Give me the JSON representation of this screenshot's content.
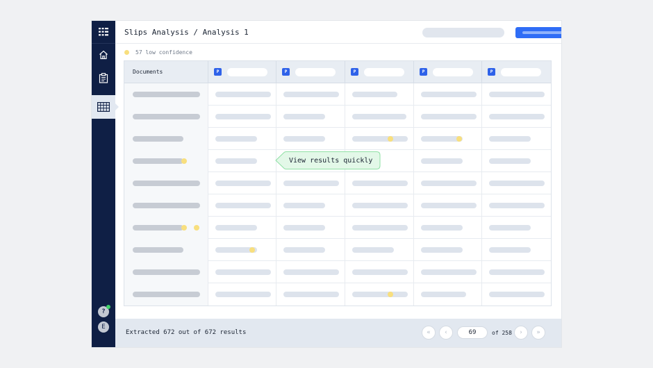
{
  "header": {
    "title": "Slips Analysis / Analysis 1"
  },
  "sidebar": {
    "items": [
      {
        "name": "app-grid-icon"
      },
      {
        "name": "home-icon"
      },
      {
        "name": "clipboard-icon"
      },
      {
        "name": "table-icon",
        "active": true
      }
    ],
    "help_label": "?",
    "user_initial": "E"
  },
  "confidence": {
    "label": "57 low confidence"
  },
  "table": {
    "documents_header": "Documents",
    "column_badge": "P"
  },
  "tooltip": {
    "text": "View results quickly"
  },
  "footer": {
    "status": "Extracted 672 out of 672 results",
    "page_input": "69",
    "page_of": "of 258",
    "first_icon": "«",
    "prev_icon": "‹",
    "next_icon": "›",
    "last_icon": "»"
  },
  "colors": {
    "sidebar": "#0f1f45",
    "accent": "#2f6df6",
    "badge": "#2f62e9",
    "low_confidence": "#f8df7e",
    "tooltip_bg": "#e3f8e8",
    "tooltip_border": "#8fe0a4"
  }
}
